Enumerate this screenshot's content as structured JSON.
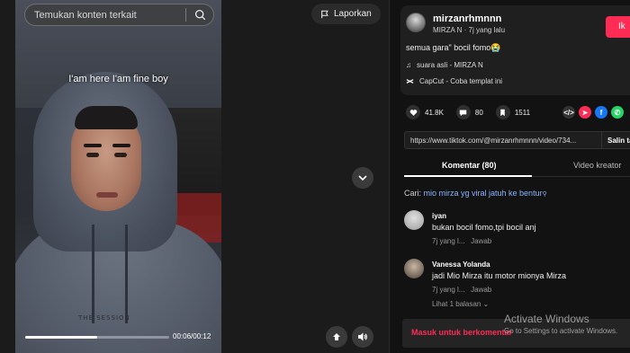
{
  "video": {
    "caption": "I'am here I'am fine boy",
    "shirt_text": "THE SESSION",
    "time": "00:06/00:12",
    "progress_fraction": 0.5
  },
  "search": {
    "placeholder": "Temukan konten terkait"
  },
  "report_label": "Laporkan",
  "author": {
    "username": "mirzanrhmnnn",
    "subline": "MIRZA N · 7j yang lalu",
    "follow_label": "Ik"
  },
  "post": {
    "description": "semua gara\" bocil fomo😭",
    "sound": "suara asli - MIRZA N",
    "capcut": "CapCut - Coba templat ini"
  },
  "stats": {
    "likes": "41.8K",
    "comments": "80",
    "saves": "1511"
  },
  "share": {
    "link": "https://www.tiktok.com/@mirzanrhmnnn/video/734...",
    "copy_label": "Salin ta"
  },
  "tabs": {
    "comments": "Komentar (80)",
    "creator": "Video kreator"
  },
  "suggestion": {
    "prefix": "Cari: ",
    "term": "mio mirza yg viral jatuh ke bentur"
  },
  "comments": [
    {
      "name": "iyan",
      "text": "bukan bocil fomo,tpi bocil anj",
      "meta": "7j yang l...   Jawab"
    },
    {
      "name": "Vanessa Yolanda",
      "text": "jadi Mio Mirza itu motor mionya Mirza",
      "meta": "7j yang l...   Jawab"
    }
  ],
  "replies_label": "Lihat 1 balasan ⌄",
  "login_label": "Masuk untuk berkomentar",
  "watermark": {
    "title": "Activate Windows",
    "subtitle": "Go to Settings to activate Windows."
  },
  "colors": {
    "accent": "#fe2c55",
    "link": "#8ab4ff",
    "background": "#121212"
  },
  "icons": [
    "search-icon",
    "flag-icon",
    "chevron-down-icon",
    "float-player-icon",
    "volume-icon",
    "music-note-icon",
    "capcut-icon",
    "heart-icon",
    "comment-icon",
    "bookmark-icon",
    "embed-icon",
    "share-icon",
    "facebook-icon",
    "whatsapp-icon"
  ]
}
